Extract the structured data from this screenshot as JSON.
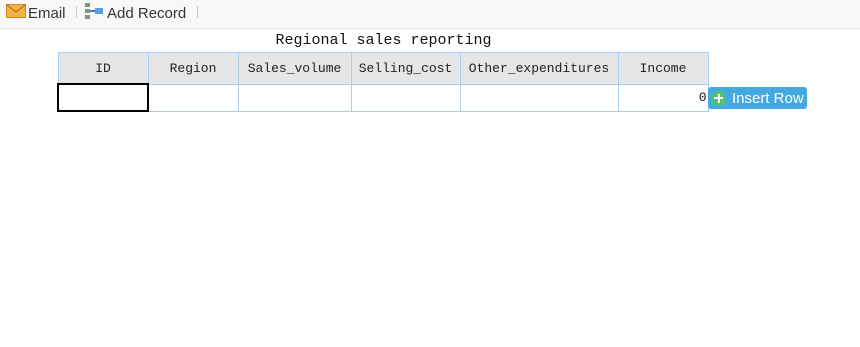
{
  "toolbar": {
    "email_label": "Email",
    "add_record_label": "Add Record"
  },
  "report": {
    "title": "Regional sales reporting",
    "columns": [
      "ID",
      "Region",
      "Sales_volume",
      "Selling_cost",
      "Other_expenditures",
      "Income"
    ],
    "rows": [
      {
        "ID": "",
        "Region": "",
        "Sales_volume": "",
        "Selling_cost": "",
        "Other_expenditures": "",
        "Income": "0"
      }
    ]
  },
  "insert_row_label": "Insert Row",
  "colors": {
    "accent_button": "#45a9e1",
    "plus_green": "#4fc36a",
    "grid_border": "#a8cff0",
    "header_bg": "#e6e6e6"
  },
  "icons": {
    "email": "envelope-icon",
    "add_record": "add-record-icon",
    "insert_row": "plus-circle-icon"
  }
}
